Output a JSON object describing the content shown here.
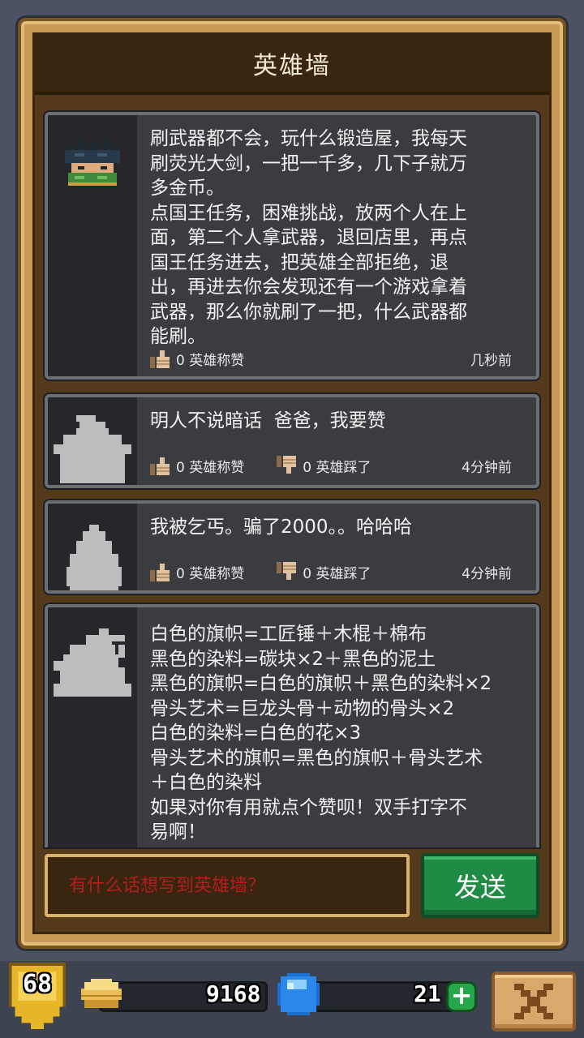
{
  "title": "英雄墙",
  "posts": [
    {
      "text": "刷武器都不会，玩什么锻造屋，我每天\n刷荧光大剑，一把一千多，几下子就万\n多金币。\n点国王任务，困难挑战，放两个人在上\n面，第二个人拿武器，退回店里，再点\n国王任务进去，把英雄全部拒绝，退\n出，再进去你会发现还有一个游戏拿着\n武器，那么你就刷了一把，什么武器都\n能刷。",
      "likes": "0 英雄称赞",
      "time": "几秒前",
      "avatar": "spiky-hair-hero-avatar"
    },
    {
      "text": "明人不说暗话  爸爸，我要赞",
      "likes": "0 英雄称赞",
      "dislikes": "0 英雄踩了",
      "time": "4分钟前",
      "avatar": "wizard-silhouette-avatar"
    },
    {
      "text": "我被乞丐。骗了2000。。哈哈哈",
      "likes": "0 英雄称赞",
      "dislikes": "0 英雄踩了",
      "time": "4分钟前",
      "avatar": "hooded-silhouette-avatar"
    },
    {
      "text": "白色的旗帜=工匠锤＋木棍＋棉布\n黑色的染料=碳块×2＋黑色的泥土\n黑色的旗帜=白色的旗帜＋黑色的染料×2\n骨头艺术=巨龙头骨＋动物的骨头×2\n白色的染料=白色的花×3\n骨头艺术的旗帜=黑色的旗帜＋骨头艺术\n＋白色的染料\n如果对你有用就点个赞呗！双手打字不\n易啊！",
      "avatar": "beast-silhouette-avatar"
    }
  ],
  "input": {
    "placeholder": "有什么话想写到英雄墙？"
  },
  "send_label": "发送",
  "status": {
    "level": "68",
    "gold": "9168",
    "gems": "21",
    "gold_icon": "gold-coin-icon",
    "gem_icon": "blue-gem-icon"
  },
  "colors": {
    "frame": "#c99a55",
    "panel": "#3a3c40",
    "send": "#1f8c45",
    "placeholder": "#b21d1d"
  }
}
